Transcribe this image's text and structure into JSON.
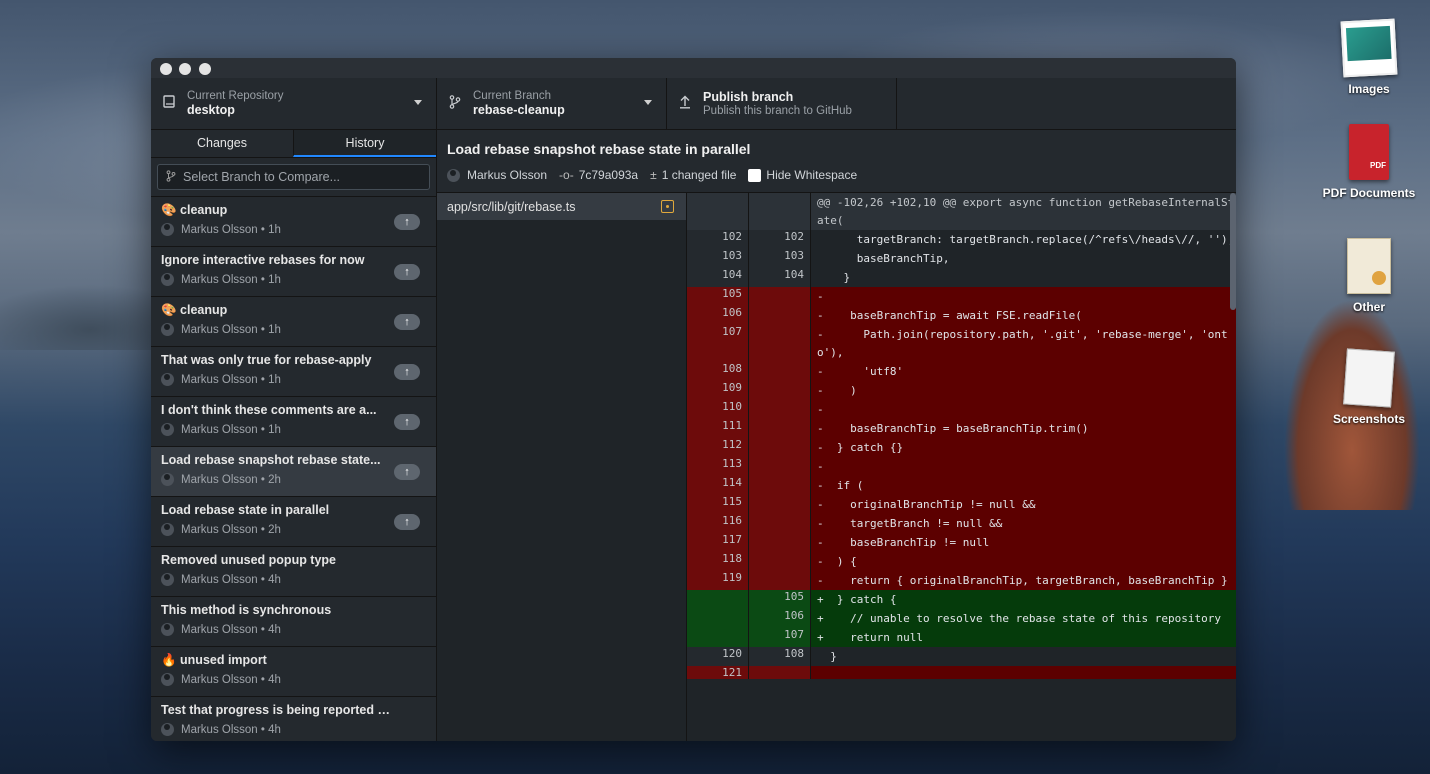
{
  "desktop": {
    "icons": [
      {
        "label": "Images",
        "icon": "images-folder-icon"
      },
      {
        "label": "PDF Documents",
        "icon": "pdf-stack-icon"
      },
      {
        "label": "Other",
        "icon": "certificate-stack-icon"
      },
      {
        "label": "Screenshots",
        "icon": "screenshots-stack-icon"
      }
    ]
  },
  "toolbar": {
    "repo": {
      "label": "Current Repository",
      "value": "desktop"
    },
    "branch": {
      "label": "Current Branch",
      "value": "rebase-cleanup"
    },
    "publish": {
      "title": "Publish branch",
      "subtitle": "Publish this branch to GitHub"
    }
  },
  "sidebar": {
    "tabs": [
      "Changes",
      "History"
    ],
    "compare_placeholder": "Select Branch to Compare...",
    "commits": [
      {
        "title": "🎨 cleanup",
        "author": "Markus Olsson",
        "time": "1h",
        "push": true
      },
      {
        "title": "Ignore interactive rebases for now",
        "author": "Markus Olsson",
        "time": "1h",
        "push": true
      },
      {
        "title": "🎨 cleanup",
        "author": "Markus Olsson",
        "time": "1h",
        "push": true
      },
      {
        "title": "That was only true for rebase-apply",
        "author": "Markus Olsson",
        "time": "1h",
        "push": true
      },
      {
        "title": "I don't think these comments are a...",
        "author": "Markus Olsson",
        "time": "1h",
        "push": true
      },
      {
        "title": "Load rebase snapshot rebase state...",
        "author": "Markus Olsson",
        "time": "2h",
        "push": true
      },
      {
        "title": "Load rebase state in parallel",
        "author": "Markus Olsson",
        "time": "2h",
        "push": true
      },
      {
        "title": "Removed unused popup type",
        "author": "Markus Olsson",
        "time": "4h",
        "push": false
      },
      {
        "title": "This method is synchronous",
        "author": "Markus Olsson",
        "time": "4h",
        "push": false
      },
      {
        "title": "🔥 unused import",
        "author": "Markus Olsson",
        "time": "4h",
        "push": false
      },
      {
        "title": "Test that progress is being reported throu...",
        "author": "Markus Olsson",
        "time": "4h",
        "push": false
      }
    ]
  },
  "commit": {
    "title": "Load rebase snapshot rebase state in parallel",
    "author": "Markus Olsson",
    "sha": "7c79a093a",
    "changed": "1 changed file",
    "hide_whitespace": "Hide Whitespace"
  },
  "files": [
    "app/src/lib/git/rebase.ts"
  ],
  "diff": {
    "hunk": "@@ -102,26 +102,10 @@ export async function getRebaseInternalState(",
    "lines": [
      {
        "t": "ctx",
        "o": "102",
        "n": "102",
        "c": "      targetBranch: targetBranch.replace(/^refs\\/heads\\//, ''),"
      },
      {
        "t": "ctx",
        "o": "103",
        "n": "103",
        "c": "      baseBranchTip,"
      },
      {
        "t": "ctx",
        "o": "104",
        "n": "104",
        "c": "    }"
      },
      {
        "t": "del",
        "o": "105",
        "n": "",
        "c": "-"
      },
      {
        "t": "del",
        "o": "106",
        "n": "",
        "c": "-    baseBranchTip = await FSE.readFile("
      },
      {
        "t": "del",
        "o": "107",
        "n": "",
        "c": "-      Path.join(repository.path, '.git', 'rebase-merge', 'onto'),"
      },
      {
        "t": "del",
        "o": "108",
        "n": "",
        "c": "-      'utf8'"
      },
      {
        "t": "del",
        "o": "109",
        "n": "",
        "c": "-    )"
      },
      {
        "t": "del",
        "o": "110",
        "n": "",
        "c": "-"
      },
      {
        "t": "del",
        "o": "111",
        "n": "",
        "c": "-    baseBranchTip = baseBranchTip.trim()"
      },
      {
        "t": "del",
        "o": "112",
        "n": "",
        "c": "-  } catch {}"
      },
      {
        "t": "del",
        "o": "113",
        "n": "",
        "c": "-"
      },
      {
        "t": "del",
        "o": "114",
        "n": "",
        "c": "-  if ("
      },
      {
        "t": "del",
        "o": "115",
        "n": "",
        "c": "-    originalBranchTip != null &&"
      },
      {
        "t": "del",
        "o": "116",
        "n": "",
        "c": "-    targetBranch != null &&"
      },
      {
        "t": "del",
        "o": "117",
        "n": "",
        "c": "-    baseBranchTip != null"
      },
      {
        "t": "del",
        "o": "118",
        "n": "",
        "c": "-  ) {"
      },
      {
        "t": "del",
        "o": "119",
        "n": "",
        "c": "-    return { originalBranchTip, targetBranch, baseBranchTip }"
      },
      {
        "t": "add",
        "o": "",
        "n": "105",
        "c": "+  } catch {"
      },
      {
        "t": "add",
        "o": "",
        "n": "106",
        "c": "+    // unable to resolve the rebase state of this repository"
      },
      {
        "t": "add",
        "o": "",
        "n": "107",
        "c": "+    return null"
      },
      {
        "t": "ctx",
        "o": "120",
        "n": "108",
        "c": "  }"
      },
      {
        "t": "del",
        "o": "121",
        "n": "",
        "c": ""
      }
    ]
  },
  "colors": {
    "accent": "#2188ff",
    "deleted": "#5c0000",
    "added": "#053b0b"
  }
}
